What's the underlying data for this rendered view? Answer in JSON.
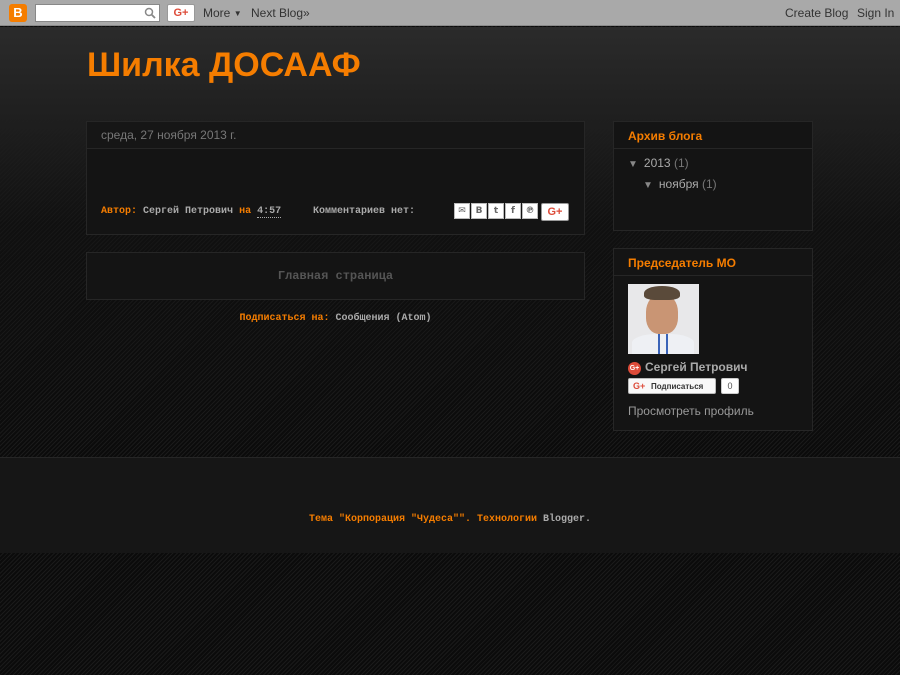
{
  "navbar": {
    "logo_letter": "B",
    "search_placeholder": "",
    "gplus_label": "G+",
    "more_label": "More",
    "next_blog_label": "Next Blog»",
    "create_blog_label": "Create Blog",
    "sign_in_label": "Sign In"
  },
  "blog": {
    "title": "Шилка ДОСААФ"
  },
  "post": {
    "date": "среда, 27 ноября 2013 г.",
    "author_prefix": "Автор:",
    "author": "Сергей Петрович",
    "at_word": "на",
    "time": "4:57",
    "comments": "Комментариев нет:",
    "share_icons": [
      "mail-icon",
      "blogger-icon",
      "twitter-icon",
      "facebook-icon",
      "pinterest-icon"
    ],
    "share_gplus": "G+"
  },
  "home": {
    "label": "Главная страница"
  },
  "subscribe": {
    "prefix": "Подписаться на:",
    "link": "Сообщения (Atom)"
  },
  "archive": {
    "title": "Архив блога",
    "items": [
      {
        "label": "2013",
        "count": "(1)"
      },
      {
        "label": "ноября",
        "count": "(1)"
      }
    ]
  },
  "profile": {
    "title": "Председатель МО",
    "name": "Сергей Петрович",
    "follow_label": "Подписаться",
    "follow_count": "0",
    "view_profile": "Просмотреть профиль"
  },
  "footer": {
    "theme_text": "Тема \"Корпорация \"Чудеса\"\". Технологии",
    "blogger_link": "Blogger",
    "end": "."
  },
  "colors": {
    "accent": "#f57d00",
    "background": "#0d0d0d",
    "panel": "#141414"
  }
}
